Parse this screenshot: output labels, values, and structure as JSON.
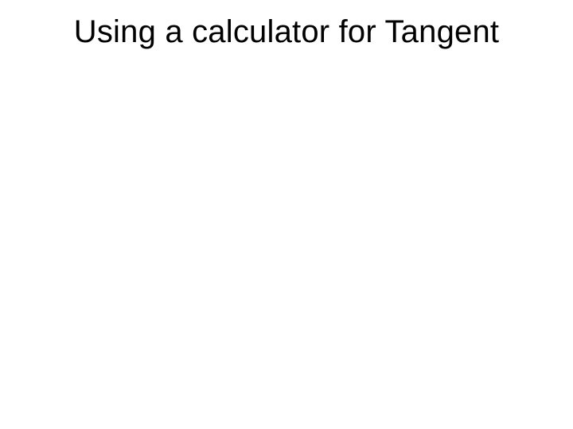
{
  "slide": {
    "title": "Using a calculator for Tangent"
  }
}
